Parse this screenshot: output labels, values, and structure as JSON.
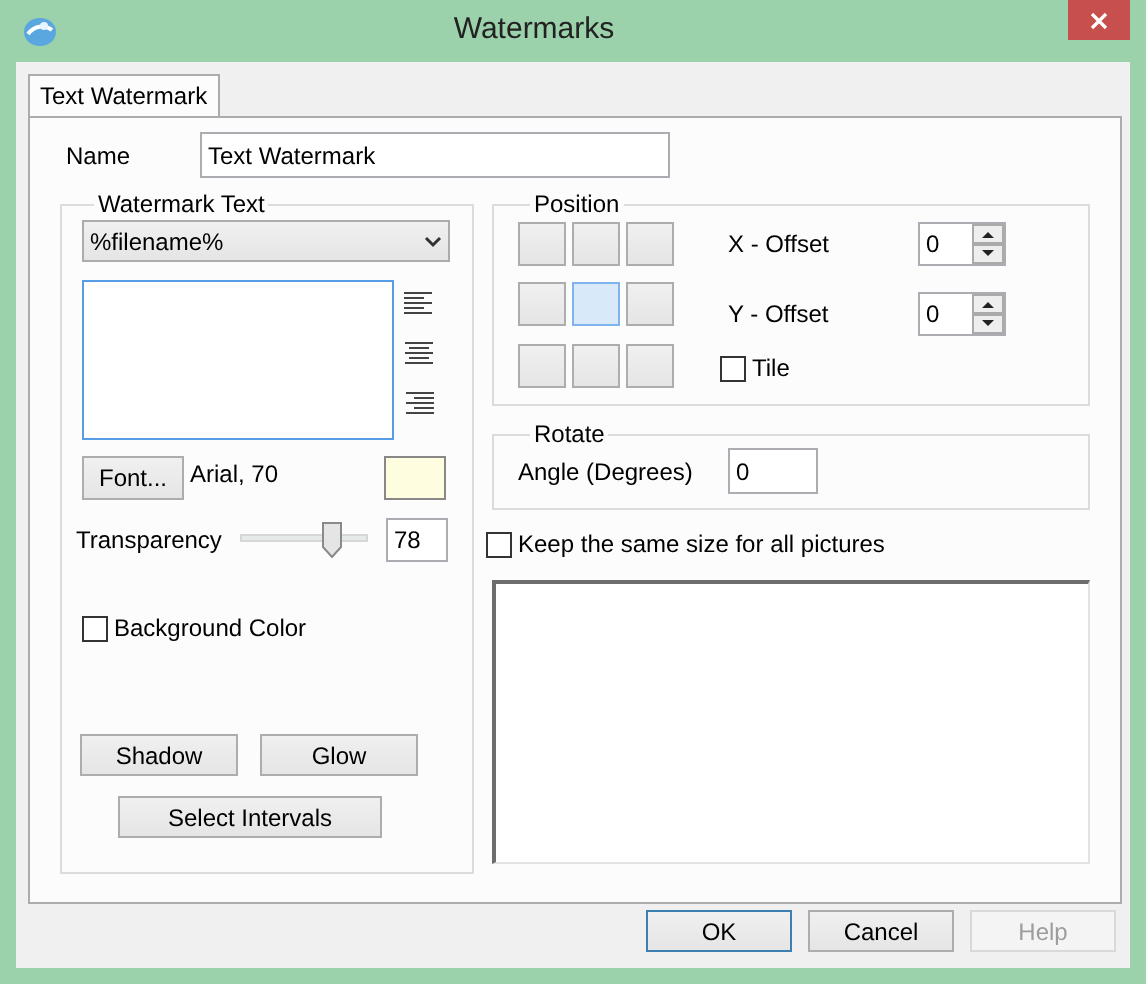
{
  "window": {
    "title": "Watermarks"
  },
  "tabs": [
    {
      "label": "Text Watermark",
      "selected": true
    }
  ],
  "name_field": {
    "label": "Name",
    "value": "Text Watermark"
  },
  "watermark_text": {
    "title": "Watermark Text",
    "dropdown": "%filename%"
  },
  "font": {
    "button": "Font...",
    "description": "Arial, 70",
    "color": "#fffde0"
  },
  "transparency": {
    "label": "Transparency",
    "level": 0.72,
    "value": "78"
  },
  "background_color": {
    "label": "Background Color",
    "checked": false
  },
  "effect_buttons": [
    "Shadow",
    "Glow"
  ],
  "intervals_button": "Select Intervals",
  "position": {
    "title": "Position",
    "cells": [
      {
        "selected": false
      },
      {
        "selected": false
      },
      {
        "selected": false
      },
      {
        "selected": false
      },
      {
        "selected": true
      },
      {
        "selected": false
      },
      {
        "selected": false
      },
      {
        "selected": false
      },
      {
        "selected": false
      }
    ],
    "offsets": [
      {
        "label": "X - Offset",
        "value": "0"
      },
      {
        "label": "Y - Offset",
        "value": "0"
      }
    ],
    "tile": {
      "label": "Tile",
      "checked": false
    }
  },
  "rotate": {
    "title": "Rotate",
    "label": "Angle (Degrees)",
    "value": "0"
  },
  "keep_size": {
    "label": "Keep the same size for all pictures",
    "checked": false
  },
  "dialog_buttons": [
    {
      "label": "OK",
      "default": true,
      "disabled": false
    },
    {
      "label": "Cancel",
      "default": false,
      "disabled": false
    },
    {
      "label": "Help",
      "default": false,
      "disabled": true
    }
  ]
}
